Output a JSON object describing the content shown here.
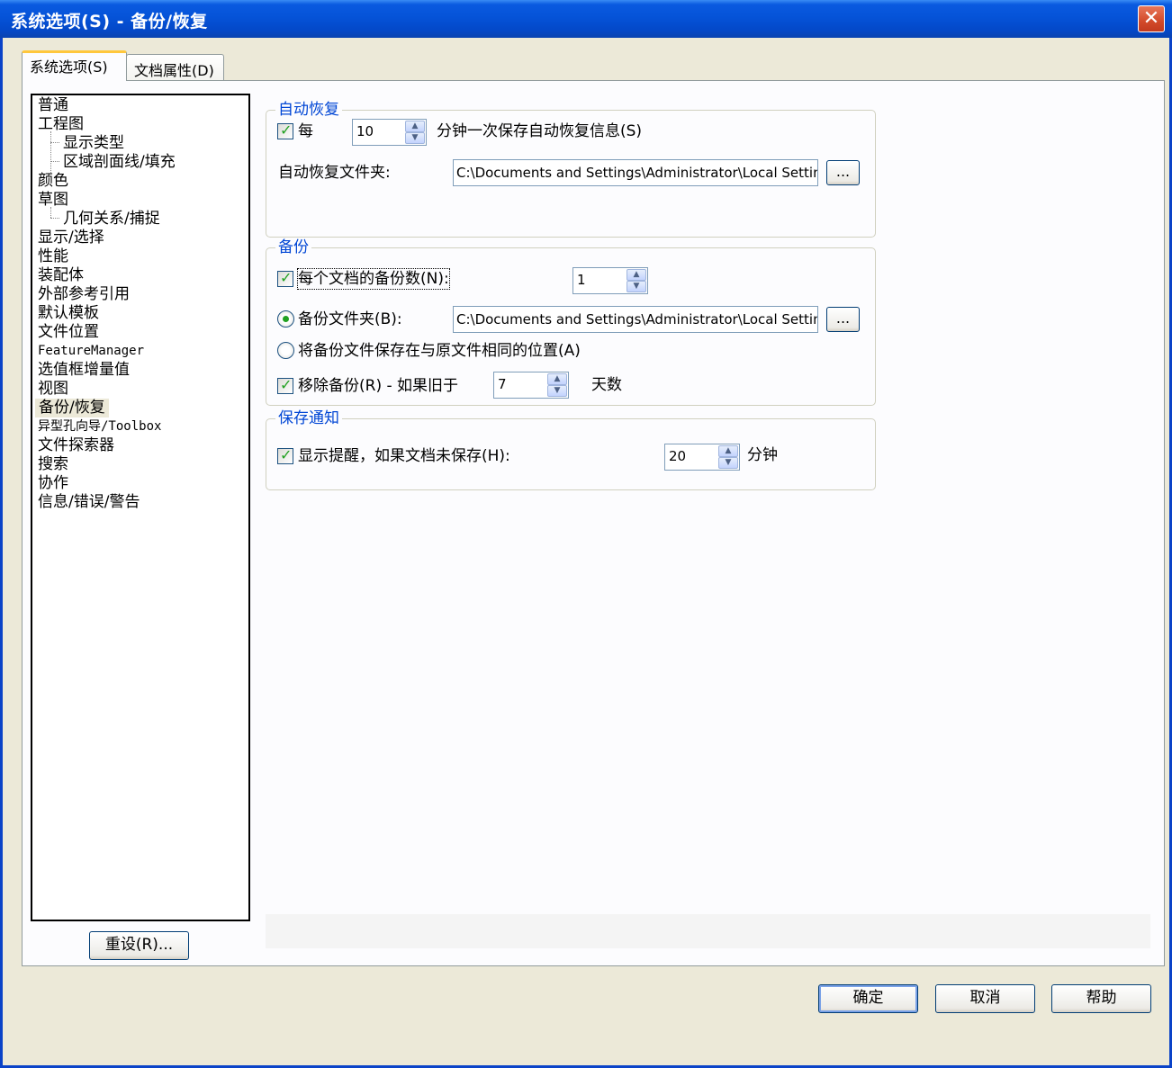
{
  "window": {
    "title": "系统选项(S) - 备份/恢复",
    "close_glyph": "✕"
  },
  "tabs": [
    {
      "label": "系统选项(S)"
    },
    {
      "label": "文档属性(D)"
    }
  ],
  "tree": {
    "items": [
      {
        "label": "普通"
      },
      {
        "label": "工程图"
      },
      {
        "label": "显示类型"
      },
      {
        "label": "区域剖面线/填充"
      },
      {
        "label": "颜色"
      },
      {
        "label": "草图"
      },
      {
        "label": "几何关系/捕捉"
      },
      {
        "label": "显示/选择"
      },
      {
        "label": "性能"
      },
      {
        "label": "装配体"
      },
      {
        "label": "外部参考引用"
      },
      {
        "label": "默认模板"
      },
      {
        "label": "文件位置"
      },
      {
        "label": "FeatureManager"
      },
      {
        "label": "选值框增量值"
      },
      {
        "label": "视图"
      },
      {
        "label": "备份/恢复"
      },
      {
        "label": "异型孔向导/Toolbox"
      },
      {
        "label": "文件探索器"
      },
      {
        "label": "搜索"
      },
      {
        "label": "协作"
      },
      {
        "label": "信息/错误/警告"
      }
    ],
    "selected": "备份/恢复"
  },
  "reset_button": "重设(R)...",
  "autorecover": {
    "title": "自动恢复",
    "every_label": "每",
    "every_checked": true,
    "minutes_value": "10",
    "minutes_suffix": "分钟一次保存自动恢复信息(S)",
    "folder_label": "自动恢复文件夹:",
    "folder_path": "C:\\Documents and Settings\\Administrator\\Local Settings",
    "browse": "..."
  },
  "backup": {
    "title": "备份",
    "copies_label": "每个文档的备份数(N):",
    "copies_checked": true,
    "copies_value": "1",
    "folder_label": "备份文件夹(B):",
    "folder_path": "C:\\Documents and Settings\\Administrator\\Local Settings",
    "browse": "...",
    "same_location_label": "将备份文件保存在与原文件相同的位置(A)",
    "remove_label": "移除备份(R) - 如果旧于",
    "remove_checked": true,
    "remove_value": "7",
    "remove_suffix": "天数"
  },
  "save_notification": {
    "title": "保存通知",
    "label": "显示提醒，如果文档未保存(H):",
    "checked": true,
    "value": "20",
    "suffix": "分钟"
  },
  "footer": {
    "ok": "确定",
    "cancel": "取消",
    "help": "帮助"
  },
  "colors": {
    "titlebar": "#0553d8",
    "group_title": "#0046d5",
    "dialog_bg": "#ece9d8",
    "check_mark": "#21a121"
  }
}
